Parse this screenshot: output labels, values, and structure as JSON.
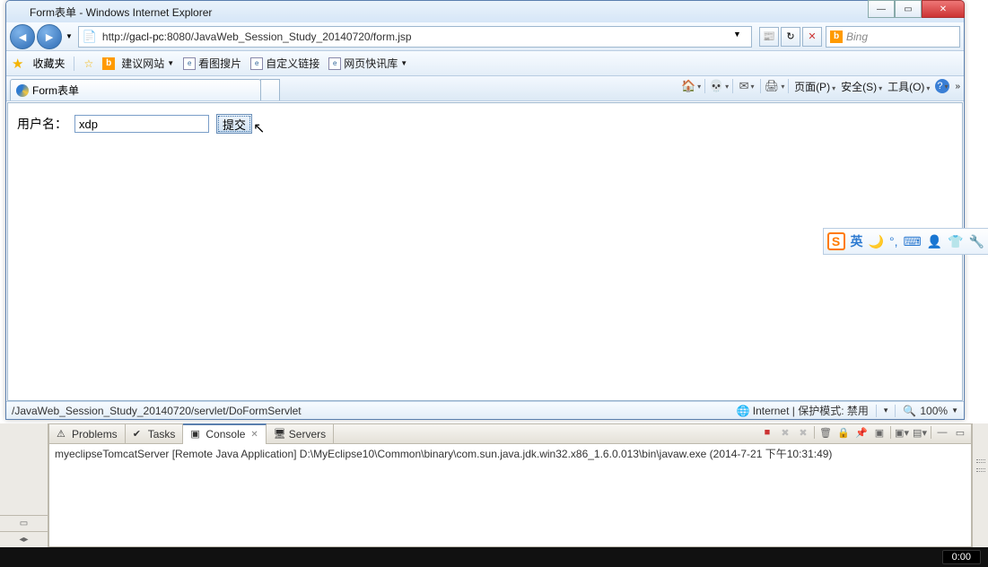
{
  "window": {
    "title": "Form表单 - Windows Internet Explorer"
  },
  "nav": {
    "url_prefix": "http://",
    "url_host": "gacl-pc",
    "url_port": ":8080",
    "url_path": "/JavaWeb_Session_Study_20140720/form.jsp",
    "search_engine": "Bing"
  },
  "favbar": {
    "favorites": "收藏夹",
    "link1": "建议网站",
    "link2": "看图搜片",
    "link3": "自定义链接",
    "link4": "网页快讯库"
  },
  "tab": {
    "title": "Form表单"
  },
  "cmdbar": {
    "page": "页面(P)",
    "safety": "安全(S)",
    "tools": "工具(O)"
  },
  "form": {
    "label": "用户名：",
    "value": "xdp",
    "submit": "提交"
  },
  "status": {
    "left": "/JavaWeb_Session_Study_20140720/servlet/DoFormServlet",
    "zone": "Internet | 保护模式: 禁用",
    "zoom": "100%"
  },
  "sogou": {
    "lang": "英"
  },
  "eclipse": {
    "tabs": {
      "problems": "Problems",
      "tasks": "Tasks",
      "console": "Console",
      "servers": "Servers"
    },
    "console_line": "myeclipseTomcatServer [Remote Java Application] D:\\MyEclipse10\\Common\\binary\\com.sun.java.jdk.win32.x86_1.6.0.013\\bin\\javaw.exe (2014-7-21 下午10:31:49)"
  },
  "taskbar": {
    "time": "0:00"
  }
}
